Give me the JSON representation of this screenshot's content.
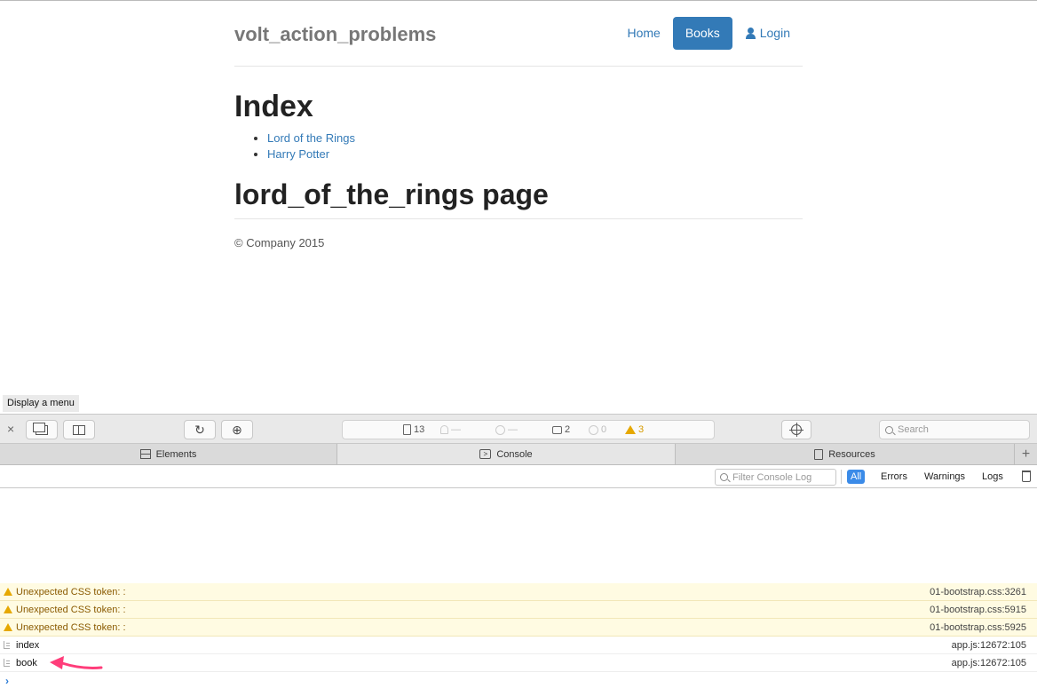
{
  "site": {
    "brand": "volt_action_problems",
    "nav": {
      "home": "Home",
      "books": "Books",
      "login": "Login"
    },
    "index_title": "Index",
    "books": [
      "Lord of the Rings",
      "Harry Potter"
    ],
    "page_title": "lord_of_the_rings page",
    "footer": "© Company 2015"
  },
  "tooltip": "Display a menu",
  "devtools": {
    "close": "×",
    "dashboard": {
      "resources": "13",
      "bell": "—",
      "time": "—",
      "logs": "2",
      "errors": "0",
      "warnings": "3"
    },
    "search_placeholder": "Search",
    "tabs": {
      "elements": "Elements",
      "console": "Console",
      "resources": "Resources",
      "add": "+"
    },
    "filter": {
      "placeholder": "Filter Console Log",
      "all": "All",
      "errors": "Errors",
      "warnings": "Warnings",
      "logs": "Logs"
    },
    "messages": [
      {
        "type": "warning",
        "text": "Unexpected CSS token: :",
        "source": "01-bootstrap.css:3261"
      },
      {
        "type": "warning",
        "text": "Unexpected CSS token: :",
        "source": "01-bootstrap.css:5915"
      },
      {
        "type": "warning",
        "text": "Unexpected CSS token: :",
        "source": "01-bootstrap.css:5925"
      },
      {
        "type": "log",
        "text": "index",
        "source": "app.js:12672:105"
      },
      {
        "type": "log",
        "text": "book",
        "source": "app.js:12672:105"
      }
    ],
    "prompt": "›"
  },
  "colors": {
    "link": "#337ab7",
    "active_filter": "#3b8be8",
    "warning": "#e6a800",
    "annotation_arrow": "#ff3d7a"
  }
}
